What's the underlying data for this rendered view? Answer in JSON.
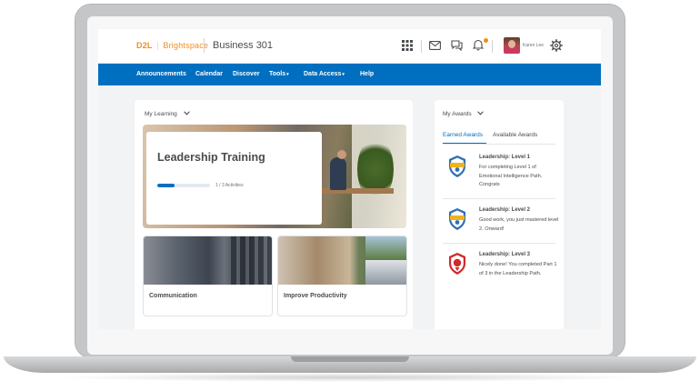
{
  "app": {
    "brand": "D2L",
    "brand_sub": "Brightspace",
    "course_title": "Business 301",
    "user_name": "Karen Lee"
  },
  "nav": {
    "items": [
      {
        "label": "Announcements"
      },
      {
        "label": "Calendar"
      },
      {
        "label": "Discover"
      },
      {
        "label": "Tools"
      },
      {
        "label": "Data Access"
      },
      {
        "label": "Help"
      }
    ]
  },
  "my_learning": {
    "header": "My Learning",
    "featured": {
      "title": "Leadership Training",
      "progress_text": "1 / 3 Activities",
      "progress_fraction": 0.33
    },
    "tiles": [
      {
        "label": "Communication"
      },
      {
        "label": "Improve Productivity"
      }
    ]
  },
  "awards": {
    "header": "My Awards",
    "tabs": [
      {
        "label": "Earned Awards",
        "active": true
      },
      {
        "label": "Available Awards",
        "active": false
      }
    ],
    "items": [
      {
        "name": "Leadership: Level 1",
        "description": "For completing Level 1 of Emotional Intelligence Path. Congrats",
        "badge_color": "#2f6fb3"
      },
      {
        "name": "Leadership: Level 2",
        "description": "Good work, you just mastered level 2. Onward!",
        "badge_color": "#2f6fb3"
      },
      {
        "name": "Leadership: Level 3",
        "description": "Nicely done! You completed Part 1 of 3 in the Leadership Path.",
        "badge_color": "#cf2a2a"
      }
    ]
  },
  "colors": {
    "brand_orange": "#f38c1f",
    "nav_blue": "#006fbf",
    "badge_gold": "#f2b21a"
  }
}
